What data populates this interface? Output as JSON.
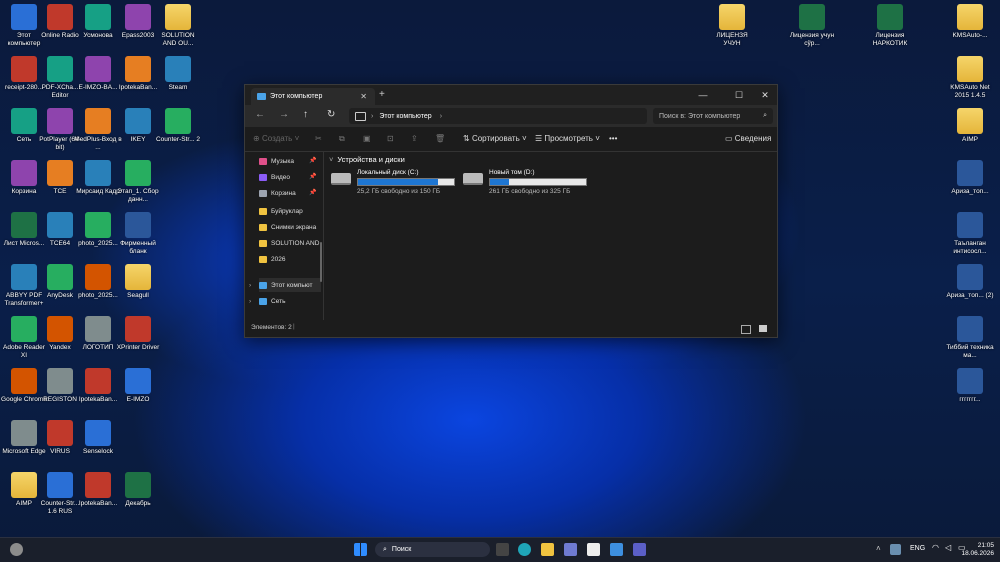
{
  "desktop": {
    "col1": [
      "Этот компьютер",
      "receipt-280...",
      "Сеть",
      "Корзина",
      "Лист Micros...",
      "ABBYY PDF Transformer+",
      "Adobe Reader XI",
      "Google Chrome",
      "Microsoft Edge",
      "AIMP"
    ],
    "col2": [
      "Online Radio",
      "PDF-XCha... Editor",
      "PotPlayer (64-bit)",
      "TCE",
      "TCE64",
      "AnyDesk",
      "Yandex",
      "REGISTON",
      "VIRUS",
      "Counter-Str... 1.6 RUS"
    ],
    "col3": [
      "Усмонова",
      "E-IMZO-BA...",
      "MedPlus-Вход в ...",
      "Мирсаид Кадр",
      "photo_2025...",
      "photo_2025...",
      "ЛОГОТИП",
      "IpotekaBan...",
      "Senselock",
      "IpotekaBan..."
    ],
    "col4": [
      "Epass2003",
      "IpotekaBan...",
      "IKEY",
      "Этап_1. Сбор данн...",
      "Фирменный бланк",
      "Seagull",
      "XPrinter Driver",
      "E-IMZO",
      "Декабрь"
    ],
    "col5": [
      "SOLUTION AND OU...",
      "Steam",
      "Counter-Str... 2"
    ],
    "right1": [
      "ЛИЦЕНЗЯ УЧУН",
      "Лицензия учун сўр...",
      "Лицензия НАРКОТИК"
    ],
    "right2": [
      "KMSAuto-...",
      "KMSAuto Net 2015 1.4.5",
      "AIMP",
      "Ариза_топ...",
      "Таъланган интисосл...",
      "Ариза_топ... (2)",
      "Тиббий техника ма...",
      "ггггггг..."
    ]
  },
  "explorer": {
    "tab_title": "Этот компьютер",
    "tab_close": "✕",
    "new_tab": "+",
    "controls": {
      "min": "—",
      "max": "☐",
      "close": "✕"
    },
    "address": "Этот компьютер",
    "search_placeholder": "Поиск в: Этот компьютер",
    "cmd": {
      "create": "Создать",
      "sort": "Сортировать",
      "view": "Просмотреть",
      "more": "•••",
      "details": "Сведения"
    },
    "sidebar": [
      {
        "label": "Музыка",
        "pinned": true
      },
      {
        "label": "Видео",
        "pinned": true
      },
      {
        "label": "Корзина",
        "pinned": true
      },
      {
        "label": "Буйруклар",
        "pinned": false
      },
      {
        "label": "Снимки экрана",
        "pinned": false
      },
      {
        "label": "SOLUTION AND",
        "pinned": false
      },
      {
        "label": "2026",
        "pinned": false
      },
      {
        "label": "Этот компьют",
        "pinned": false
      },
      {
        "label": "Сеть",
        "pinned": false
      }
    ],
    "section_title": "Устройства и диски",
    "drives": [
      {
        "name": "Локальный диск (C:)",
        "free": "25,2 ГБ свободно из 150 ГБ",
        "used_fraction": 0.83
      },
      {
        "name": "Новый том (D:)",
        "free": "261 ГБ свободно из 325 ГБ",
        "used_fraction": 0.2
      }
    ],
    "status": "Элементов: 2"
  },
  "taskbar": {
    "search": "Поиск",
    "lang": "ENG",
    "time": "21:05",
    "date": "18.06.2026"
  }
}
